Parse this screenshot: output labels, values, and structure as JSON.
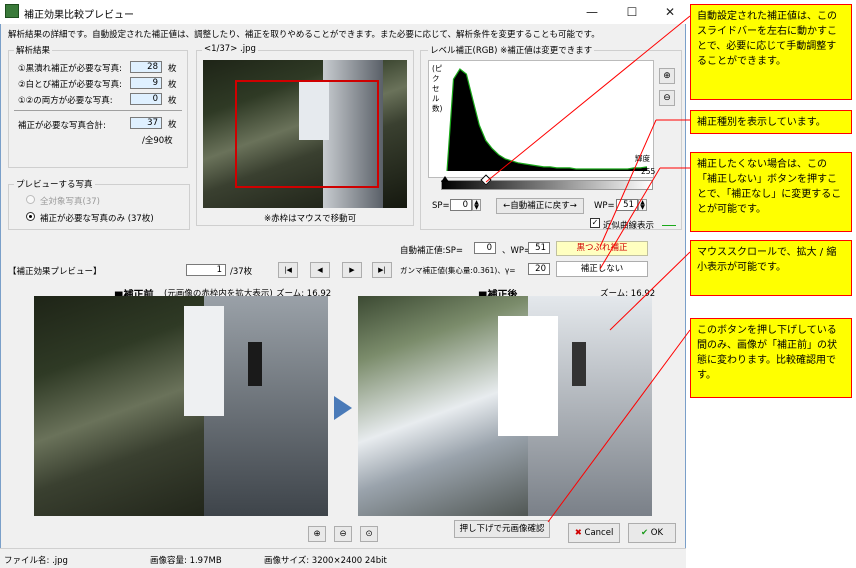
{
  "window": {
    "title": "補正効果比較プレビュー",
    "minimize": "—",
    "maximize": "☐",
    "close": "✕"
  },
  "description": "解析結果の詳細です。自動設定された補正値は、調整したり、補正を取りやめることができます。また必要に応じて、解析条件を変更することも可能です。",
  "analysis": {
    "title": "解析結果",
    "rows": [
      {
        "label": "①黒潰れ補正が必要な写真:",
        "value": "28",
        "unit": "枚"
      },
      {
        "label": "②白とび補正が必要な写真:",
        "value": "9",
        "unit": "枚"
      },
      {
        "label": "①②の両方が必要な写真:",
        "value": "0",
        "unit": "枚"
      }
    ],
    "total_label": "補正が必要な写真合計:",
    "total_value": "37",
    "total_unit": "枚",
    "total_sub": "/全90枚"
  },
  "preview_photos": {
    "title": "プレビューする写真",
    "option_all": "全対象写真(37)",
    "option_needed": "補正が必要な写真のみ (37枚)"
  },
  "thumb": {
    "caption": "<1/37> .jpg",
    "note": "※赤枠はマウスで移動可"
  },
  "level": {
    "title": "レベル補正(RGB) ※補正値は変更できます",
    "ylabel": "(ピクセル数)",
    "xlabel_right": "輝度",
    "xmax": "255",
    "sp_label": "SP=",
    "sp_value": "0",
    "wp_label": "WP=",
    "wp_value": "51",
    "reset_button": "←自動補正に戻す→",
    "checkbox_label": "近似曲線表示"
  },
  "auto": {
    "label_sp": "自動補正値:SP=",
    "sp": "0",
    "label_wp": "、WP=",
    "wp": "51",
    "badge": "黒つぶれ補正",
    "gamma_label": "ガンマ補正値(集心量:0.361)、γ=",
    "gamma": "20",
    "no_correct_button": "補正しない"
  },
  "effect": {
    "title": "【補正効果プレビュー】",
    "page": "1",
    "page_total": "/37枚",
    "nav_first": "|◀",
    "nav_prev": "◀",
    "nav_next": "▶",
    "nav_last": "▶|",
    "before_title": "■補正前",
    "before_sub": "(元画像の赤枠内を拡大表示)",
    "before_zoom": "ズーム: 16.92",
    "after_title": "■補正後",
    "after_zoom": "ズーム: 16.92",
    "hold_button": "押し下げで元画像確認",
    "cancel": "Cancel",
    "ok": "OK"
  },
  "status": {
    "filename": "ファイル名: .jpg",
    "filesize": "画像容量: 1.97MB",
    "imagesize": "画像サイズ: 3200×2400 24bit"
  },
  "callouts": [
    "自動設定された補正値は、このスライドバーを左右に動かすことで、必要に応じて手動調整することができます。",
    "補正種別を表示しています。",
    "補正したくない場合は、この「補正しない」ボタンを押すことで、「補正なし」に変更することが可能です。",
    "マウススクロールで、拡大 / 縮小表示が可能です。",
    "このボタンを押し下げしている間のみ、画像が「補正前」の状態に変わります。比較確認用です。"
  ],
  "histogram": {
    "type": "area",
    "xlim": [
      0,
      255
    ],
    "peak_bin": 8,
    "shape": [
      0,
      90,
      100,
      95,
      70,
      45,
      30,
      22,
      16,
      12,
      10,
      8,
      7,
      6,
      5,
      4,
      4,
      3,
      3,
      3,
      2,
      2,
      2,
      2,
      2,
      2,
      2,
      2,
      2,
      3,
      3,
      4
    ]
  }
}
